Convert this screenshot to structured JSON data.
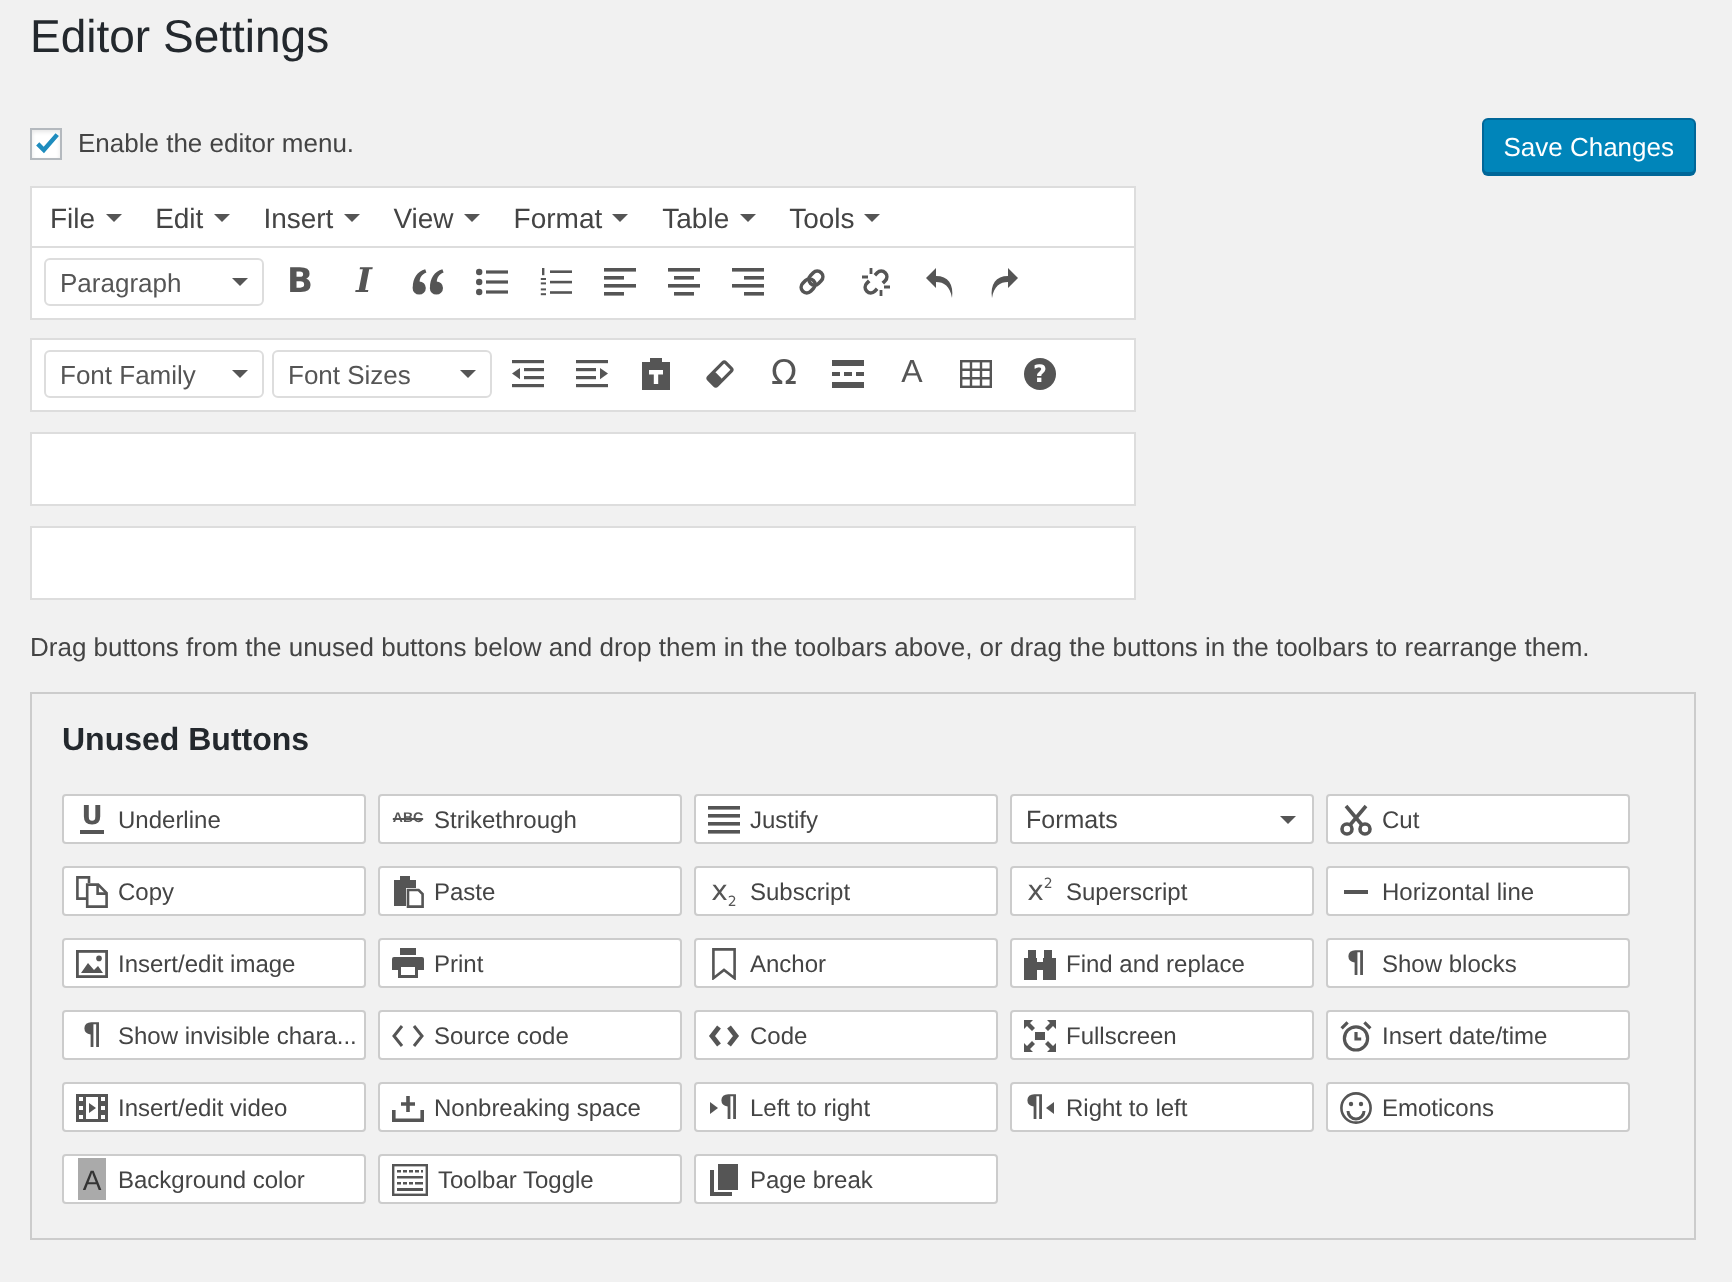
{
  "page_title": "Editor Settings",
  "menu_option": {
    "label": "Enable the editor menu.",
    "checked": true
  },
  "save_button": "Save Changes",
  "editor": {
    "menubar": [
      "File",
      "Edit",
      "Insert",
      "View",
      "Format",
      "Table",
      "Tools"
    ],
    "toolbar": [
      {
        "kind": "select",
        "label": "Paragraph"
      },
      {
        "kind": "bold",
        "glyph": "B"
      },
      {
        "kind": "italic",
        "glyph": "I"
      },
      {
        "kind": "blockquote"
      },
      {
        "kind": "bullist"
      },
      {
        "kind": "numlist"
      },
      {
        "kind": "alignleft"
      },
      {
        "kind": "aligncenter"
      },
      {
        "kind": "alignright"
      },
      {
        "kind": "link"
      },
      {
        "kind": "unlink"
      },
      {
        "kind": "undo"
      },
      {
        "kind": "redo"
      }
    ]
  },
  "toolbars": [
    {
      "kind": "filled",
      "items": [
        {
          "kind": "select",
          "label": "Font Family"
        },
        {
          "kind": "select",
          "label": "Font Sizes"
        },
        {
          "kind": "outdent"
        },
        {
          "kind": "indent"
        },
        {
          "kind": "pastetext"
        },
        {
          "kind": "removeformat"
        },
        {
          "kind": "charmap",
          "glyph": "Ω"
        },
        {
          "kind": "more"
        },
        {
          "kind": "forecolor",
          "glyph": "A"
        },
        {
          "kind": "table"
        },
        {
          "kind": "help",
          "glyph": "?"
        }
      ]
    },
    {
      "kind": "empty"
    },
    {
      "kind": "empty"
    }
  ],
  "instructions": "Drag buttons from the unused buttons below and drop them in the toolbars above, or drag the buttons in the toolbars to rearrange them.",
  "unused": {
    "title": "Unused Buttons",
    "buttons": [
      {
        "kind": "underline",
        "glyph": "U",
        "label": "Underline"
      },
      {
        "kind": "strikethrough",
        "glyph": "ABC",
        "label": "Strikethrough"
      },
      {
        "kind": "justify",
        "label": "Justify"
      },
      {
        "kind": "select",
        "label": "Formats"
      },
      {
        "kind": "cut",
        "label": "Cut"
      },
      {
        "kind": "copy",
        "label": "Copy"
      },
      {
        "kind": "paste",
        "label": "Paste"
      },
      {
        "kind": "subscript",
        "glyph": "x$_{2}$",
        "label": "Subscript"
      },
      {
        "kind": "superscript",
        "glyph": "x$^{2}$",
        "label": "Superscript"
      },
      {
        "kind": "hr",
        "label": "Horizontal line"
      },
      {
        "kind": "image",
        "label": "Insert/edit image"
      },
      {
        "kind": "print",
        "label": "Print"
      },
      {
        "kind": "anchor",
        "label": "Anchor"
      },
      {
        "kind": "searchreplace",
        "label": "Find and replace"
      },
      {
        "kind": "showblocks",
        "glyph": "¶",
        "label": "Show blocks"
      },
      {
        "kind": "visualchars",
        "glyph": "¶",
        "label": "Show invisible chara..."
      },
      {
        "kind": "sourcecode",
        "label": "Source code"
      },
      {
        "kind": "code",
        "label": "Code"
      },
      {
        "kind": "fullscreen",
        "label": "Fullscreen"
      },
      {
        "kind": "datetime",
        "label": "Insert date/time"
      },
      {
        "kind": "media",
        "label": "Insert/edit video"
      },
      {
        "kind": "nonbreaking",
        "label": "Nonbreaking space"
      },
      {
        "kind": "ltr",
        "glyph": "¶",
        "label": "Left to right"
      },
      {
        "kind": "rtl",
        "glyph": "¶",
        "label": "Right to left"
      },
      {
        "kind": "emoticons",
        "label": "Emoticons"
      },
      {
        "kind": "backcolor",
        "glyph": "A",
        "label": "Background color"
      },
      {
        "kind": "toolbartoggle",
        "label": "Toolbar Toggle"
      },
      {
        "kind": "pagebreak",
        "label": "Page break"
      }
    ]
  }
}
